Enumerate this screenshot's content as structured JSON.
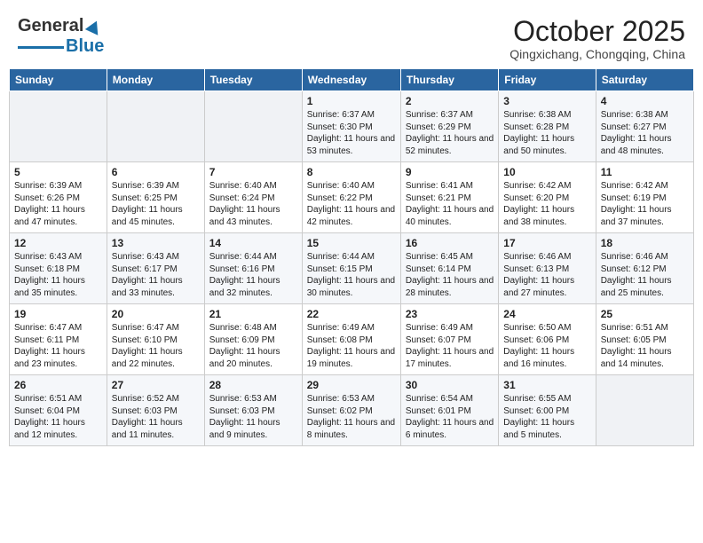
{
  "header": {
    "logo_general": "General",
    "logo_blue": "Blue",
    "title": "October 2025",
    "subtitle": "Qingxichang, Chongqing, China"
  },
  "days_of_week": [
    "Sunday",
    "Monday",
    "Tuesday",
    "Wednesday",
    "Thursday",
    "Friday",
    "Saturday"
  ],
  "weeks": [
    [
      {
        "day": "",
        "info": ""
      },
      {
        "day": "",
        "info": ""
      },
      {
        "day": "",
        "info": ""
      },
      {
        "day": "1",
        "info": "Sunrise: 6:37 AM\nSunset: 6:30 PM\nDaylight: 11 hours and 53 minutes."
      },
      {
        "day": "2",
        "info": "Sunrise: 6:37 AM\nSunset: 6:29 PM\nDaylight: 11 hours and 52 minutes."
      },
      {
        "day": "3",
        "info": "Sunrise: 6:38 AM\nSunset: 6:28 PM\nDaylight: 11 hours and 50 minutes."
      },
      {
        "day": "4",
        "info": "Sunrise: 6:38 AM\nSunset: 6:27 PM\nDaylight: 11 hours and 48 minutes."
      }
    ],
    [
      {
        "day": "5",
        "info": "Sunrise: 6:39 AM\nSunset: 6:26 PM\nDaylight: 11 hours and 47 minutes."
      },
      {
        "day": "6",
        "info": "Sunrise: 6:39 AM\nSunset: 6:25 PM\nDaylight: 11 hours and 45 minutes."
      },
      {
        "day": "7",
        "info": "Sunrise: 6:40 AM\nSunset: 6:24 PM\nDaylight: 11 hours and 43 minutes."
      },
      {
        "day": "8",
        "info": "Sunrise: 6:40 AM\nSunset: 6:22 PM\nDaylight: 11 hours and 42 minutes."
      },
      {
        "day": "9",
        "info": "Sunrise: 6:41 AM\nSunset: 6:21 PM\nDaylight: 11 hours and 40 minutes."
      },
      {
        "day": "10",
        "info": "Sunrise: 6:42 AM\nSunset: 6:20 PM\nDaylight: 11 hours and 38 minutes."
      },
      {
        "day": "11",
        "info": "Sunrise: 6:42 AM\nSunset: 6:19 PM\nDaylight: 11 hours and 37 minutes."
      }
    ],
    [
      {
        "day": "12",
        "info": "Sunrise: 6:43 AM\nSunset: 6:18 PM\nDaylight: 11 hours and 35 minutes."
      },
      {
        "day": "13",
        "info": "Sunrise: 6:43 AM\nSunset: 6:17 PM\nDaylight: 11 hours and 33 minutes."
      },
      {
        "day": "14",
        "info": "Sunrise: 6:44 AM\nSunset: 6:16 PM\nDaylight: 11 hours and 32 minutes."
      },
      {
        "day": "15",
        "info": "Sunrise: 6:44 AM\nSunset: 6:15 PM\nDaylight: 11 hours and 30 minutes."
      },
      {
        "day": "16",
        "info": "Sunrise: 6:45 AM\nSunset: 6:14 PM\nDaylight: 11 hours and 28 minutes."
      },
      {
        "day": "17",
        "info": "Sunrise: 6:46 AM\nSunset: 6:13 PM\nDaylight: 11 hours and 27 minutes."
      },
      {
        "day": "18",
        "info": "Sunrise: 6:46 AM\nSunset: 6:12 PM\nDaylight: 11 hours and 25 minutes."
      }
    ],
    [
      {
        "day": "19",
        "info": "Sunrise: 6:47 AM\nSunset: 6:11 PM\nDaylight: 11 hours and 23 minutes."
      },
      {
        "day": "20",
        "info": "Sunrise: 6:47 AM\nSunset: 6:10 PM\nDaylight: 11 hours and 22 minutes."
      },
      {
        "day": "21",
        "info": "Sunrise: 6:48 AM\nSunset: 6:09 PM\nDaylight: 11 hours and 20 minutes."
      },
      {
        "day": "22",
        "info": "Sunrise: 6:49 AM\nSunset: 6:08 PM\nDaylight: 11 hours and 19 minutes."
      },
      {
        "day": "23",
        "info": "Sunrise: 6:49 AM\nSunset: 6:07 PM\nDaylight: 11 hours and 17 minutes."
      },
      {
        "day": "24",
        "info": "Sunrise: 6:50 AM\nSunset: 6:06 PM\nDaylight: 11 hours and 16 minutes."
      },
      {
        "day": "25",
        "info": "Sunrise: 6:51 AM\nSunset: 6:05 PM\nDaylight: 11 hours and 14 minutes."
      }
    ],
    [
      {
        "day": "26",
        "info": "Sunrise: 6:51 AM\nSunset: 6:04 PM\nDaylight: 11 hours and 12 minutes."
      },
      {
        "day": "27",
        "info": "Sunrise: 6:52 AM\nSunset: 6:03 PM\nDaylight: 11 hours and 11 minutes."
      },
      {
        "day": "28",
        "info": "Sunrise: 6:53 AM\nSunset: 6:03 PM\nDaylight: 11 hours and 9 minutes."
      },
      {
        "day": "29",
        "info": "Sunrise: 6:53 AM\nSunset: 6:02 PM\nDaylight: 11 hours and 8 minutes."
      },
      {
        "day": "30",
        "info": "Sunrise: 6:54 AM\nSunset: 6:01 PM\nDaylight: 11 hours and 6 minutes."
      },
      {
        "day": "31",
        "info": "Sunrise: 6:55 AM\nSunset: 6:00 PM\nDaylight: 11 hours and 5 minutes."
      },
      {
        "day": "",
        "info": ""
      }
    ]
  ]
}
